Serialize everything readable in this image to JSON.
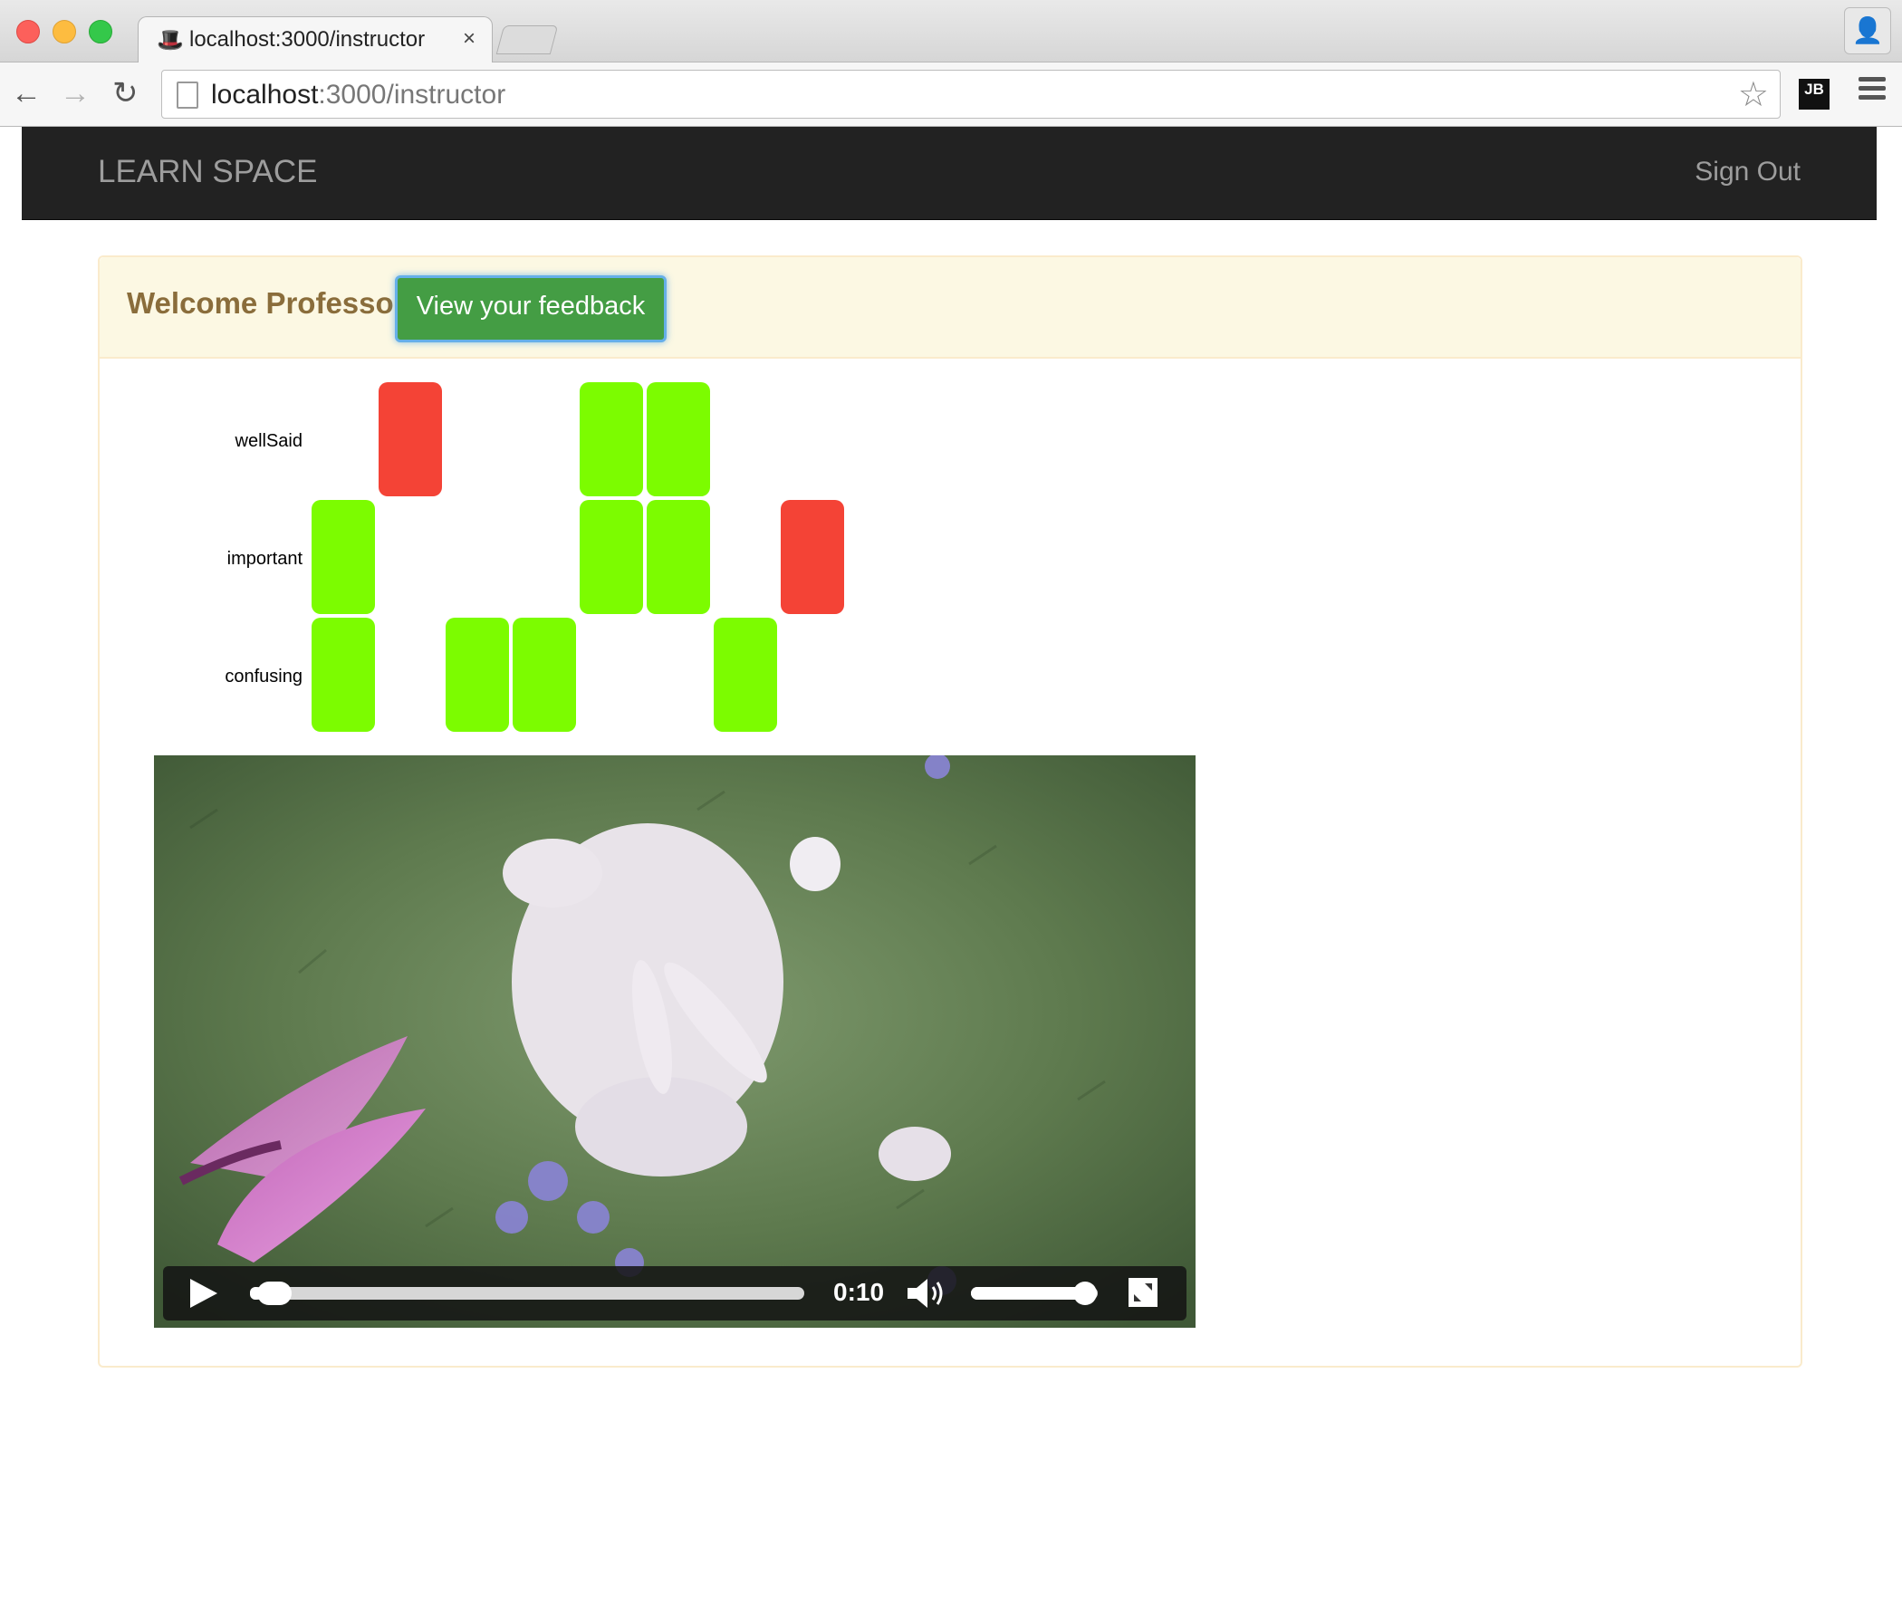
{
  "browser": {
    "tab_title": "localhost:3000/instructor",
    "tab_close": "×",
    "favicon": "🎩",
    "url_host": "localhost",
    "url_path": ":3000/instructor",
    "back_glyph": "←",
    "forward_glyph": "→",
    "reload_glyph": "↻",
    "star_glyph": "☆",
    "profile_glyph": "👤",
    "extension_label": "JB"
  },
  "navbar": {
    "brand": "LEARN SPACE",
    "sign_out": "Sign Out"
  },
  "panel": {
    "welcome": "Welcome Professor",
    "feedback_button": "View your feedback"
  },
  "chart_data": {
    "type": "heatmap",
    "rows": [
      "wellSaid",
      "important",
      "confusing"
    ],
    "columns": 8,
    "cells": [
      [
        null,
        "red",
        null,
        null,
        "green",
        "green",
        null,
        null
      ],
      [
        "green",
        null,
        null,
        null,
        "green",
        "green",
        null,
        "red"
      ],
      [
        "green",
        null,
        "green",
        "green",
        null,
        null,
        "green",
        null
      ]
    ],
    "colors": {
      "green": "#7cfc00",
      "red": "#f44336"
    }
  },
  "video": {
    "time": "0:10",
    "progress": 0.02,
    "volume": 0.9
  }
}
